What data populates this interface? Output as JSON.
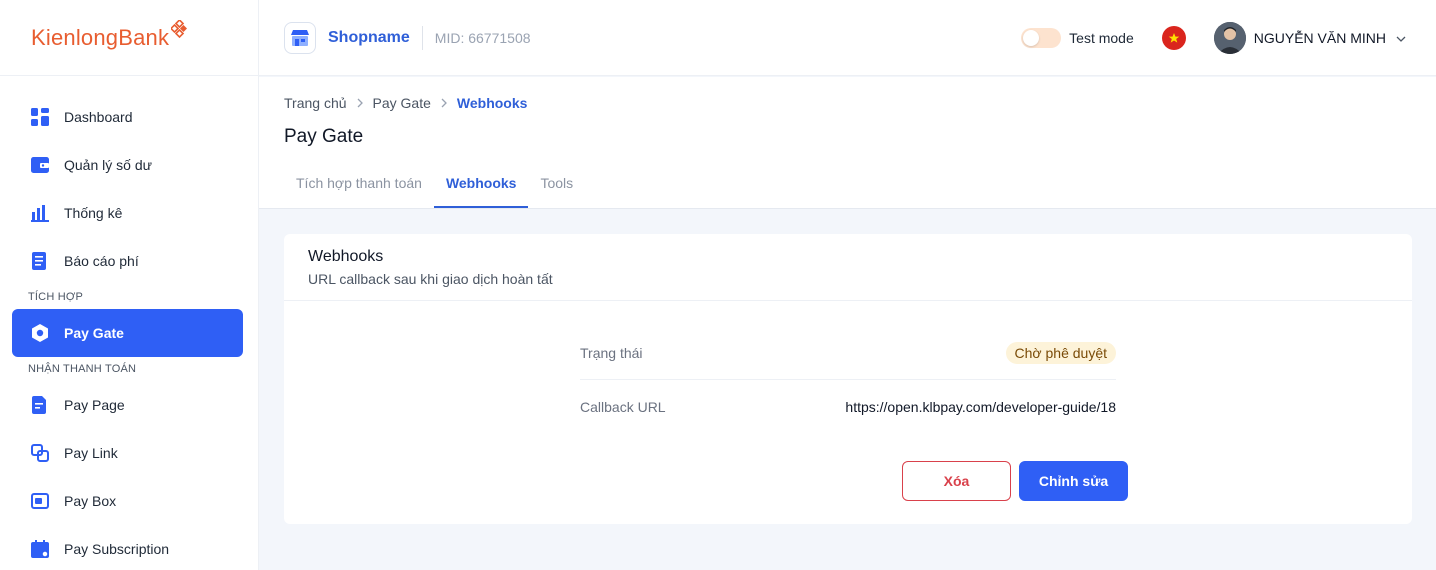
{
  "brand": {
    "name_part1": "Kienlong",
    "name_part2": "Bank",
    "color": "#e85d30"
  },
  "sidebar": {
    "items": [
      {
        "label": "Dashboard",
        "icon": "dashboard-icon"
      },
      {
        "label": "Quản lý số dư",
        "icon": "wallet-icon"
      },
      {
        "label": "Thống kê",
        "icon": "bar-chart-icon"
      },
      {
        "label": "Báo cáo phí",
        "icon": "report-icon"
      }
    ],
    "section_integration": "TÍCH HỢP",
    "integration_items": [
      {
        "label": "Pay Gate",
        "icon": "gate-icon",
        "active": true
      }
    ],
    "section_payment": "NHẬN THANH TOÁN",
    "payment_items": [
      {
        "label": "Pay Page",
        "icon": "page-icon"
      },
      {
        "label": "Pay Link",
        "icon": "link-icon"
      },
      {
        "label": "Pay Box",
        "icon": "box-icon"
      },
      {
        "label": "Pay Subscription",
        "icon": "calendar-icon"
      }
    ]
  },
  "header": {
    "shop_name": "Shopname",
    "mid": "MID: 66771508",
    "test_mode_label": "Test mode",
    "test_mode_on": false,
    "language_flag": "vietnam-flag-icon",
    "user_name": "NGUYỄN VĂN MINH"
  },
  "breadcrumb": [
    "Trang chủ",
    "Pay Gate",
    "Webhooks"
  ],
  "page": {
    "title": "Pay Gate",
    "tabs": [
      {
        "label": "Tích hợp thanh toán",
        "active": false
      },
      {
        "label": "Webhooks",
        "active": true
      },
      {
        "label": "Tools",
        "active": false
      }
    ]
  },
  "webhooks": {
    "title": "Webhooks",
    "subtitle": "URL callback sau khi giao dịch hoàn tất",
    "status_label": "Trạng thái",
    "status_value": "Chờ phê duyệt",
    "callback_label": "Callback URL",
    "callback_value": "https://open.klbpay.com/developer-guide/18",
    "delete_label": "Xóa",
    "edit_label": "Chỉnh sửa"
  },
  "colors": {
    "accent": "#2f5ff5",
    "danger": "#d9414b",
    "pending_bg": "#fdf3d9"
  }
}
